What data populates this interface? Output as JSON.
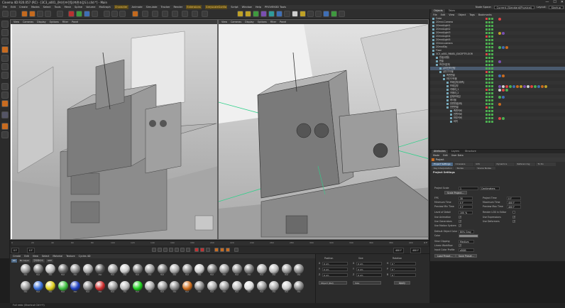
{
  "window": {
    "title": "Cinema 4D R20.057 (RC) - [3C3_a001_큐라인프린팅(측면조감도).c4d *] - Main",
    "buttons": [
      "—",
      "☐",
      "✕"
    ]
  },
  "menubar": {
    "items": [
      "File",
      "Edit",
      "Create",
      "Modes",
      "Select",
      "Tools",
      "Mesh",
      "Spline",
      "Volume",
      "MoGraph",
      "Character",
      "Animate",
      "Simulate",
      "Tracker",
      "Render",
      "Extensions",
      "GreyscaleGorilla",
      "Script",
      "Window",
      "Help",
      "PROVEN3D Tools"
    ],
    "highlight_indexes": [
      10,
      15,
      16
    ],
    "node_space_label": "Node Space:",
    "node_space_value": "Current (Standard/Physical)",
    "layout_label": "Layout:",
    "layout_value": "Startup"
  },
  "viewport_left": {
    "menu": [
      "View",
      "Cameras",
      "Display",
      "Options",
      "Filter",
      "Panel"
    ],
    "tag": "Default Camera ◦◦"
  },
  "viewport_right": {
    "menu": [
      "View",
      "Cameras",
      "Display",
      "Options",
      "Filter",
      "Panel"
    ],
    "tag_left": "Perspective",
    "tag_right": "Default Camera ◦◦"
  },
  "object_manager": {
    "tabs": [
      "Objects",
      "Takes"
    ],
    "menu": [
      "File",
      "Edit",
      "View",
      "Object",
      "Tags",
      "Bookmarks"
    ],
    "objects": [
      {
        "name": "Cube",
        "depth": 0,
        "sel": false
      },
      {
        "name": "2Omni.Camera",
        "depth": 0,
        "sel": false
      },
      {
        "name": "2OmniLight1",
        "depth": 0,
        "sel": false
      },
      {
        "name": "2OmniLight2",
        "depth": 0,
        "sel": false
      },
      {
        "name": "2OmniLight3",
        "depth": 0,
        "sel": false
      },
      {
        "name": "2OmniLight4",
        "depth": 0,
        "sel": false
      },
      {
        "name": "2OmniLight5",
        "depth": 0,
        "sel": false
      },
      {
        "name": "2Omni.camera",
        "depth": 0,
        "sel": false
      },
      {
        "name": "2OmniSky",
        "depth": 0,
        "sel": false
      },
      {
        "name": "Floor",
        "depth": 0,
        "sel": false
      },
      {
        "name": "3C3_a001_PANEL_EXCEPTFLOOR",
        "depth": 0,
        "sel": false
      },
      {
        "name": "판넬(대형)",
        "depth": 1,
        "sel": false
      },
      {
        "name": "판넬",
        "depth": 1,
        "sel": false
      },
      {
        "name": "프린터본체",
        "depth": 1,
        "sel": false
      },
      {
        "name": "큐라인프린팅",
        "depth": 2,
        "sel": true
      },
      {
        "name": "상단기구물",
        "depth": 2,
        "sel": false
      },
      {
        "name": "측면판넬",
        "depth": 3,
        "sel": false
      },
      {
        "name": "하단구조물",
        "depth": 3,
        "sel": false
      },
      {
        "name": "프레임부(좌측)",
        "depth": 4,
        "sel": false
      },
      {
        "name": "프레임부",
        "depth": 4,
        "sel": false
      },
      {
        "name": "카메라_1",
        "depth": 4,
        "sel": false
      },
      {
        "name": "카메라_2",
        "depth": 4,
        "sel": false
      },
      {
        "name": "본체프레임",
        "depth": 4,
        "sel": false
      },
      {
        "name": "케이블",
        "depth": 4,
        "sel": false
      },
      {
        "name": "전면판넬(좌)",
        "depth": 4,
        "sel": false
      },
      {
        "name": "전면판넬",
        "depth": 4,
        "sel": false
      },
      {
        "name": "측면커버",
        "depth": 5,
        "sel": false
      },
      {
        "name": "전면커버",
        "depth": 5,
        "sel": false
      },
      {
        "name": "하부커버",
        "depth": 5,
        "sel": false
      },
      {
        "name": "바퀴",
        "depth": 5,
        "sel": false
      }
    ]
  },
  "attribute_manager": {
    "header_tabs": [
      "Attributes",
      "Layers",
      "Structure"
    ],
    "menu": [
      "Mode",
      "Edit",
      "User Data"
    ],
    "mode_label": "Project",
    "tabs": [
      "Project Settings",
      "Cineware",
      "Info",
      "Dynamics",
      "Referencing",
      "To Do",
      "Key Interpolation",
      "Nodes",
      "Scene Nodes"
    ],
    "active_tab": "Project Settings",
    "section_title": "Project Settings",
    "project_scale_label": "Project Scale",
    "project_scale_value": "1",
    "project_scale_unit": "Centimeters",
    "scale_project_button": "Scale Project...",
    "fps_label": "FPS",
    "fps_value": "30",
    "project_time_label": "Project Time",
    "project_time_value": "0 F",
    "min_time_label": "Minimum Time",
    "min_time_value": "0 F",
    "max_time_label": "Maximum Time",
    "max_time_value": "400 F",
    "preview_min_label": "Preview Min Time",
    "preview_min_value": "0 F",
    "preview_max_label": "Preview Max Time",
    "preview_max_value": "400 F",
    "lod_label": "Level of Detail",
    "lod_value": "100 %",
    "render_lod_label": "Render LOD in Editor",
    "use_animation_label": "Use Animation",
    "use_expression_label": "Use Expressions",
    "use_generators_label": "Use Generators",
    "use_deformers_label": "Use Deformers",
    "use_motion_label": "Use Motion System",
    "default_color_label": "Default Object Color",
    "default_color_value": "80% Gray",
    "color_label": "Color",
    "view_clipping_label": "View Clipping",
    "view_clipping_value": "Medium",
    "linear_workflow_label": "Linear Workflow",
    "input_color_label": "Input Color Profile",
    "input_color_value": "sRGB",
    "load_preset_button": "Load Preset...",
    "save_preset_button": "Save Preset..."
  },
  "timeline": {
    "ticks": [
      "0",
      "20",
      "40",
      "60",
      "80",
      "100",
      "120",
      "140",
      "160",
      "180",
      "200",
      "220",
      "240",
      "260",
      "280",
      "300",
      "320",
      "340",
      "360",
      "380",
      "400"
    ],
    "end_label": "0 F",
    "start_field": "0 F",
    "current_field": "0 F",
    "end_field": "400 F",
    "max_field": "400 F"
  },
  "material_manager": {
    "menu": [
      "Create",
      "Edit",
      "View",
      "Select",
      "Material",
      "Texture",
      "Cycles 4D"
    ],
    "filters": [
      "All",
      "No Layer",
      "현재레이어",
      "GRP"
    ],
    "active_filter": "All",
    "materials": [
      "Mat",
      "Mat",
      "Mat",
      "Mat",
      "Mat",
      "Mat",
      "Mat",
      "Mat",
      "Mat",
      "Mat",
      "Mat",
      "Mat",
      "Mat",
      "Mat",
      "Mat",
      "Mat",
      "Mat",
      "Mat",
      "Mat",
      "Mat",
      "Mat",
      "Mat",
      "Mat",
      "Mat",
      "Mat",
      "Mat",
      "Mat",
      "Mat",
      "Mat",
      "Mat",
      "Mat",
      "Mat",
      "Mat",
      "Mat",
      "Mat",
      "Mat",
      "Mat",
      "Mat",
      "Mat",
      "Mat",
      "Mat",
      "Mat",
      "Mat",
      "Mat",
      "Mat",
      "Mat"
    ],
    "colors": [
      "#999999",
      "#777777",
      "#bbbbbb",
      "#666666",
      "#888888",
      "#aaaaaa",
      "#555555",
      "#999999",
      "#cccccc",
      "#777777",
      "#999999",
      "#777777",
      "#aaaaaa",
      "#888888",
      "#cccccc",
      "#777777",
      "#999999",
      "#888888",
      "#777777",
      "#aaaaaa",
      "#bbbbbb",
      "#999999",
      "#888888",
      "#999999",
      "#3a6fd8",
      "#e0d020",
      "#40c040",
      "#2040c0",
      "#888888",
      "#d03030",
      "#999999",
      "#bbbbbb",
      "#20d020",
      "#aaaaaa",
      "#999999",
      "#888888",
      "#d07020",
      "#888888",
      "#aaaaaa",
      "#999999",
      "#bbbbbb",
      "#dddddd",
      "#999999",
      "#aaaaaa",
      "#cccccc",
      "#888888"
    ]
  },
  "coordinates": {
    "headers": [
      "Position",
      "Size",
      "Rotation"
    ],
    "rows": [
      {
        "axis": "X",
        "pos": "0 cm",
        "axis2": "X",
        "size": "0 cm",
        "axis3": "H",
        "rot": "0 °"
      },
      {
        "axis": "Y",
        "pos": "0 cm",
        "axis2": "Y",
        "size": "0 cm",
        "axis3": "P",
        "rot": "0 °"
      },
      {
        "axis": "Z",
        "pos": "0 cm",
        "axis2": "Z",
        "size": "0 cm",
        "axis3": "B",
        "rot": "0 °"
      }
    ],
    "mode_value": "Object (Rel)",
    "size_value": "Size",
    "apply_button": "Apply"
  },
  "status": {
    "text": "Full redo (Shortcut Ctrl+Y)"
  },
  "colors": {
    "accent": "#c86b20",
    "selection": "#4e6a88",
    "viewport_bg": "#bdbdbd"
  }
}
